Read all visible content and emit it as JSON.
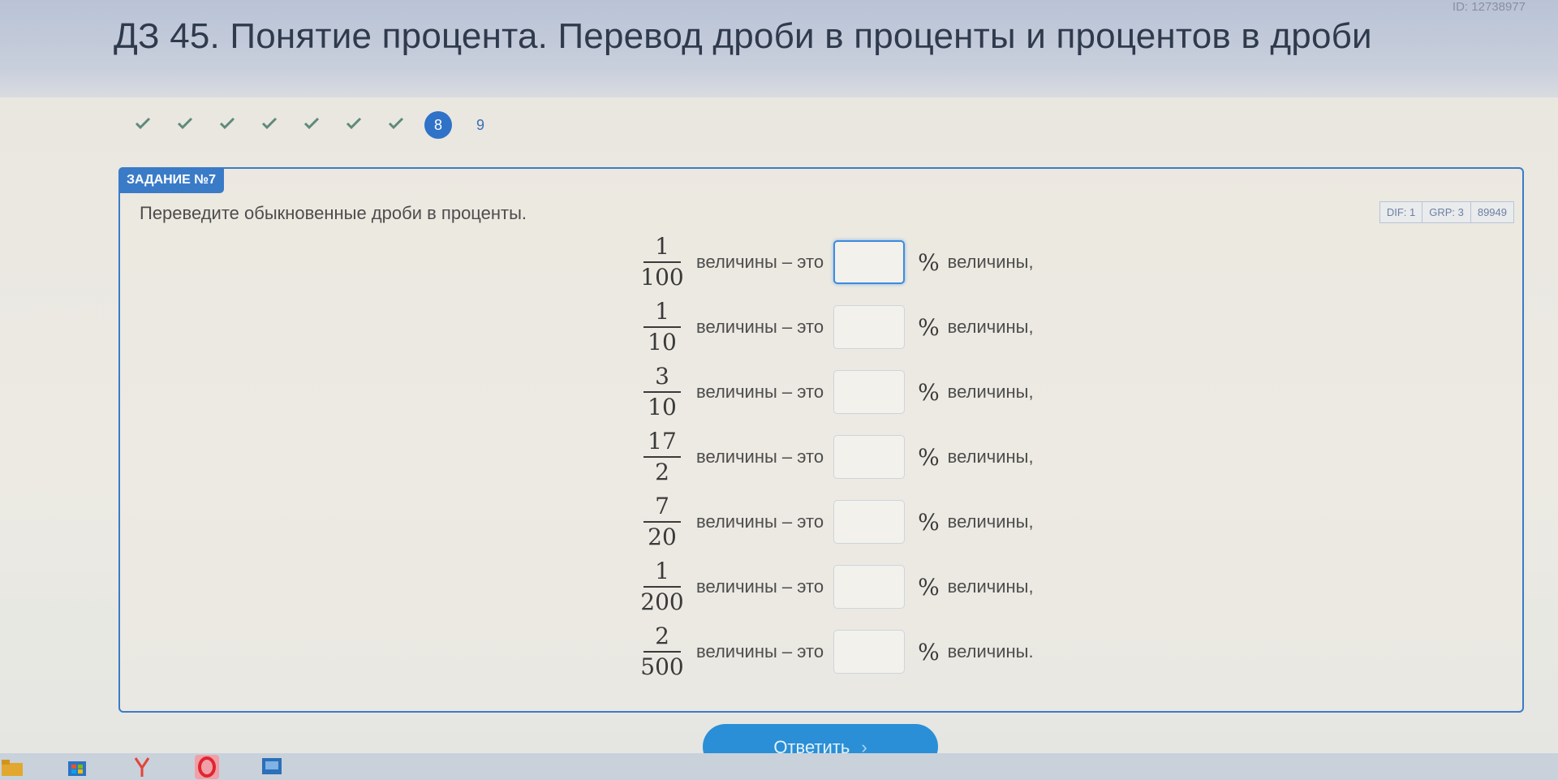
{
  "header": {
    "title": "ДЗ 45. Понятие процента. Перевод дроби в проценты и процентов в дроби",
    "id_label": "ID: 12738977"
  },
  "steps": {
    "completed_count": 7,
    "current": "8",
    "next": "9"
  },
  "task": {
    "badge": "Задание №7",
    "meta": [
      "DIF: 1",
      "GRP: 3",
      "89949"
    ],
    "instruction": "Переведите обыкновенные дроби в проценты.",
    "rows": [
      {
        "num": "1",
        "den": "100",
        "word": "величины – это",
        "value": "",
        "percent": "%",
        "tail": "величины,"
      },
      {
        "num": "1",
        "den": "10",
        "word": "величины – это",
        "value": "",
        "percent": "%",
        "tail": "величины,"
      },
      {
        "num": "3",
        "den": "10",
        "word": "величины – это",
        "value": "",
        "percent": "%",
        "tail": "величины,"
      },
      {
        "num": "17",
        "den": "2",
        "word": "величины – это",
        "value": "",
        "percent": "%",
        "tail": "величины,"
      },
      {
        "num": "7",
        "den": "20",
        "word": "величины – это",
        "value": "",
        "percent": "%",
        "tail": "величины,"
      },
      {
        "num": "1",
        "den": "200",
        "word": "величины – это",
        "value": "",
        "percent": "%",
        "tail": "величины,"
      },
      {
        "num": "2",
        "den": "500",
        "word": "величины – это",
        "value": "",
        "percent": "%",
        "tail": "величины."
      }
    ]
  },
  "actions": {
    "submit_label": "Ответить",
    "submit_arrow": "›"
  },
  "taskbar": {
    "icons": [
      "folder-icon",
      "store-icon",
      "yandex-icon",
      "opera-icon",
      "app-icon"
    ]
  },
  "colors": {
    "accent": "#3a7bc8",
    "button": "#2a8fd6",
    "check": "#5f8a7a"
  }
}
